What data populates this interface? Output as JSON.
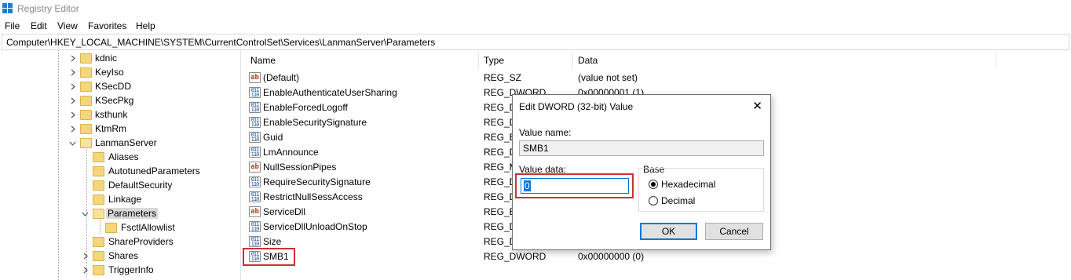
{
  "window": {
    "title": "Registry Editor"
  },
  "menu": [
    "File",
    "Edit",
    "View",
    "Favorites",
    "Help"
  ],
  "address": "Computer\\HKEY_LOCAL_MACHINE\\SYSTEM\\CurrentControlSet\\Services\\LanmanServer\\Parameters",
  "tree": [
    {
      "label": "kdnic",
      "expander": "collapsed"
    },
    {
      "label": "KeyIso",
      "expander": "collapsed"
    },
    {
      "label": "KSecDD",
      "expander": "collapsed"
    },
    {
      "label": "KSecPkg",
      "expander": "collapsed"
    },
    {
      "label": "ksthunk",
      "expander": "collapsed"
    },
    {
      "label": "KtmRm",
      "expander": "collapsed"
    },
    {
      "label": "LanmanServer",
      "expander": "expanded"
    },
    {
      "label": "Aliases",
      "expander": "none"
    },
    {
      "label": "AutotunedParameters",
      "expander": "none"
    },
    {
      "label": "DefaultSecurity",
      "expander": "none"
    },
    {
      "label": "Linkage",
      "expander": "none"
    },
    {
      "label": "Parameters",
      "expander": "expanded",
      "selected": true
    },
    {
      "label": "FsctlAllowlist",
      "expander": "none"
    },
    {
      "label": "ShareProviders",
      "expander": "none"
    },
    {
      "label": "Shares",
      "expander": "collapsed"
    },
    {
      "label": "TriggerInfo",
      "expander": "collapsed"
    }
  ],
  "columns": {
    "name": "Name",
    "type": "Type",
    "data": "Data"
  },
  "values": [
    {
      "name": "(Default)",
      "icon": "string-value-icon",
      "type": "REG_SZ",
      "data": "(value not set)"
    },
    {
      "name": "EnableAuthenticateUserSharing",
      "icon": "dword-value-icon",
      "type": "REG_DWORD",
      "data": "0x00000001 (1)"
    },
    {
      "name": "EnableForcedLogoff",
      "icon": "dword-value-icon",
      "type": "REG_DW",
      "data": ""
    },
    {
      "name": "EnableSecuritySignature",
      "icon": "dword-value-icon",
      "type": "REG_DW",
      "data": ""
    },
    {
      "name": "Guid",
      "icon": "dword-value-icon",
      "type": "REG_BI",
      "data": ""
    },
    {
      "name": "LmAnnounce",
      "icon": "dword-value-icon",
      "type": "REG_DW",
      "data": ""
    },
    {
      "name": "NullSessionPipes",
      "icon": "string-value-icon",
      "type": "REG_M",
      "data": ""
    },
    {
      "name": "RequireSecuritySignature",
      "icon": "dword-value-icon",
      "type": "REG_DW",
      "data": ""
    },
    {
      "name": "RestrictNullSessAccess",
      "icon": "dword-value-icon",
      "type": "REG_DW",
      "data": ""
    },
    {
      "name": "ServiceDll",
      "icon": "string-value-icon",
      "type": "REG_EX",
      "data": ""
    },
    {
      "name": "ServiceDllUnloadOnStop",
      "icon": "dword-value-icon",
      "type": "REG_DW",
      "data": ""
    },
    {
      "name": "Size",
      "icon": "dword-value-icon",
      "type": "REG_DW",
      "data": ""
    },
    {
      "name": "SMB1",
      "icon": "dword-value-icon",
      "type": "REG_DWORD",
      "data": "0x00000000 (0)"
    }
  ],
  "dialog": {
    "title": "Edit DWORD (32-bit) Value",
    "value_name_label": "Value name:",
    "value_name": "SMB1",
    "value_data_label": "Value data:",
    "value_data": "0",
    "base_label": "Base",
    "hex_label": "Hexadecimal",
    "decimal_label": "Decimal",
    "selected_base": "Hexadecimal",
    "ok_label": "OK",
    "cancel_label": "Cancel"
  },
  "colors": {
    "highlight_box": "#c8323a",
    "folder": "#f4d67b",
    "focus": "#0078d7"
  }
}
